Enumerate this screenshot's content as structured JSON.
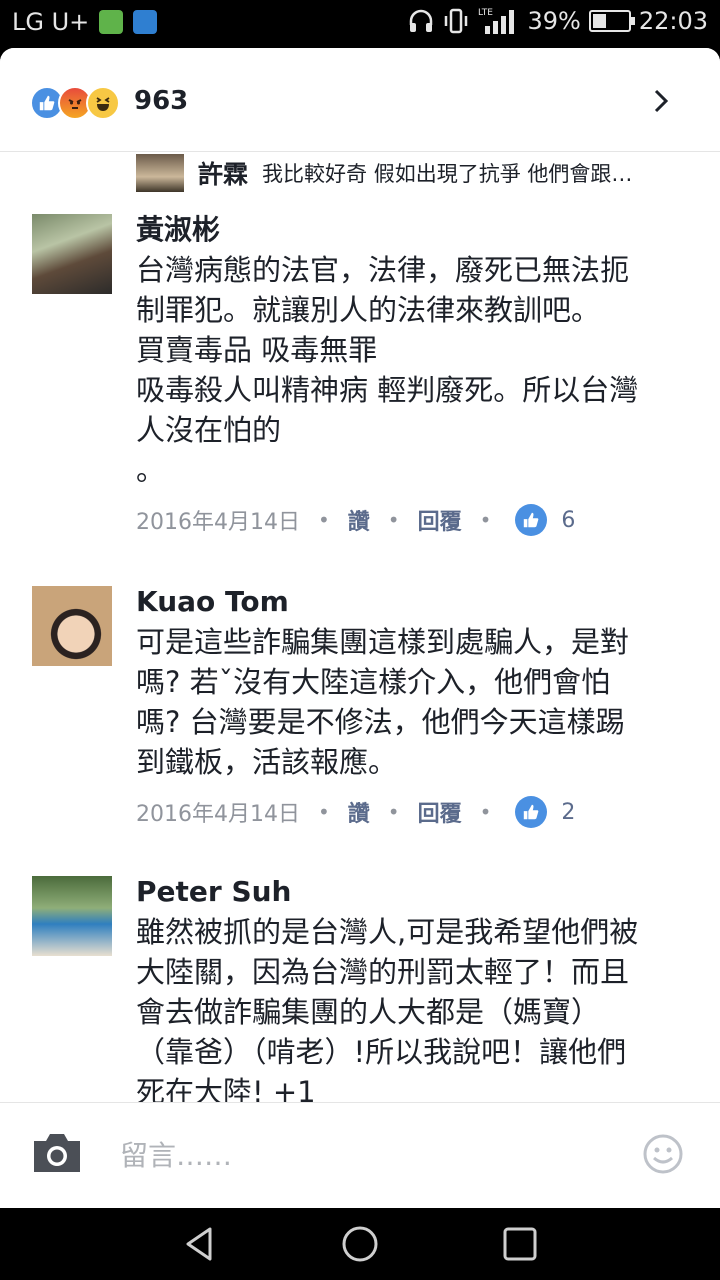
{
  "status_bar": {
    "carrier": "LG U+",
    "network": "LTE",
    "battery": "39%",
    "battery_level": 0.39,
    "time": "22:03"
  },
  "reactions": {
    "icons": [
      "like-icon",
      "angry-icon",
      "haha-icon"
    ],
    "count": "963"
  },
  "preview": {
    "name": "許霖",
    "text": "我比較好奇 假如出現了抗爭 他們會跟…"
  },
  "comments": [
    {
      "name": "黃淑彬",
      "text": "台灣病態的法官，法律，廢死已無法扼\n制罪犯。就讓別人的法律來教訓吧。\n買賣毒品 吸毒無罪\n吸毒殺人叫精神病 輕判廢死。所以台灣\n人沒在怕的\n。",
      "date": "2016年4月14日",
      "like_label": "讚",
      "reply_label": "回覆",
      "likes": "6"
    },
    {
      "name": "Kuao Tom",
      "text": "可是這些詐騙集團這樣到處騙人，是對\n嗎? 若ˇ沒有大陸這樣介入，他們會怕\n嗎? 台灣要是不修法，他們今天這樣踢\n到鐵板，活該報應。",
      "date": "2016年4月14日",
      "like_label": "讚",
      "reply_label": "回覆",
      "likes": "2"
    },
    {
      "name": "Peter  Suh",
      "text": "雖然被抓的是台灣人,可是我希望他們被\n大陸關，因為台灣的刑罰太輕了！而且\n會去做詐騙集團的人大都是（媽寶）\n（靠爸）（啃老）!所以我說吧！讓他們\n死在大陸! +1"
    }
  ],
  "composer": {
    "placeholder": "留言……"
  },
  "colors": {
    "like_blue": "#4a90e2",
    "text": "#1d2129",
    "meta_gray": "#90949c",
    "action_blue": "#5b6b8c"
  }
}
